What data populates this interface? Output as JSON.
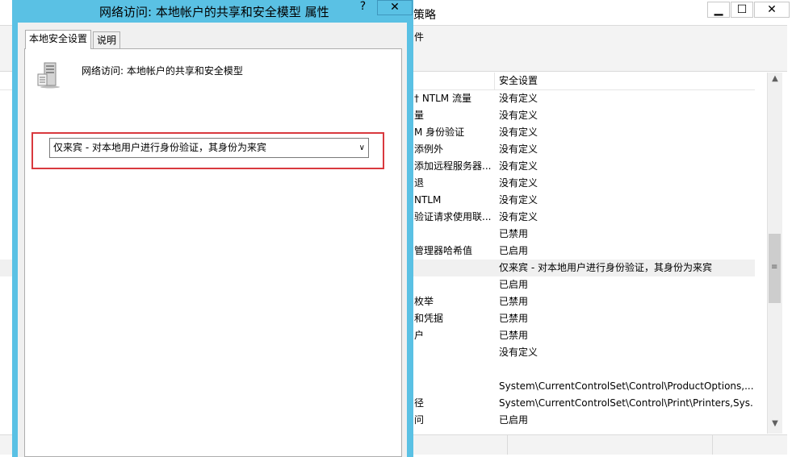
{
  "background_window": {
    "title_fragment": "策略",
    "controls": {
      "minimize": "▁",
      "maximize": "☐",
      "close": "✕"
    },
    "menu_fragment": "件",
    "column_header": "安全设置",
    "rows": [
      {
        "name": "† NTLM 流量",
        "value": "没有定义"
      },
      {
        "name": "量",
        "value": "没有定义"
      },
      {
        "name": "M 身份验证",
        "value": "没有定义"
      },
      {
        "name": "添例外",
        "value": "没有定义"
      },
      {
        "name": "添加远程服务器...",
        "value": "没有定义"
      },
      {
        "name": "退",
        "value": "没有定义"
      },
      {
        "name": "NTLM",
        "value": "没有定义"
      },
      {
        "name": "验证请求使用联...",
        "value": "没有定义"
      },
      {
        "name": "",
        "value": "已禁用"
      },
      {
        "name": "管理器哈希值",
        "value": "已启用"
      },
      {
        "name": "",
        "value": "仅来宾 - 对本地用户进行身份验证，其身份为来宾",
        "selected": true
      },
      {
        "name": "",
        "value": "已启用"
      },
      {
        "name": "枚举",
        "value": "已禁用"
      },
      {
        "name": "和凭据",
        "value": "已禁用"
      },
      {
        "name": "户",
        "value": "已禁用"
      },
      {
        "name": "",
        "value": "没有定义"
      },
      {
        "name": "",
        "value": ""
      },
      {
        "name": "",
        "value": "System\\CurrentControlSet\\Control\\ProductOptions,..."
      },
      {
        "name": "径",
        "value": "System\\CurrentControlSet\\Control\\Print\\Printers,Sys..."
      },
      {
        "name": "问",
        "value": "已启用"
      }
    ]
  },
  "dialog": {
    "title": "网络访问: 本地帐户的共享和安全模型 属性",
    "help_label": "?",
    "close_label": "✕",
    "tabs": [
      {
        "label": "本地安全设置",
        "active": true
      },
      {
        "label": "说明",
        "active": false
      }
    ],
    "policy_name": "网络访问: 本地帐户的共享和安全模型",
    "selected_option": "仅来宾 - 对本地用户进行身份验证，其身份为来宾",
    "colors": {
      "title_bar": "#5ac1e4",
      "highlight_border": "#d9393e"
    }
  }
}
